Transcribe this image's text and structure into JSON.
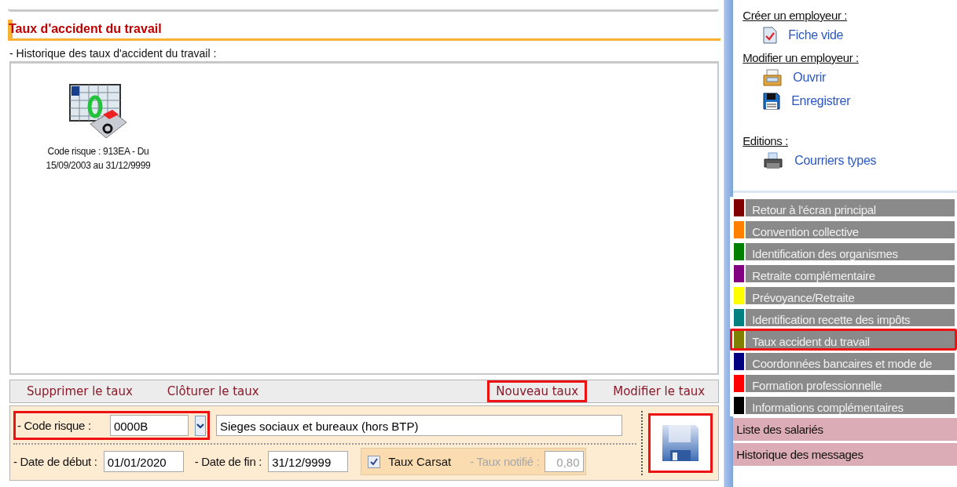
{
  "section": {
    "title": "Taux d'accident du travail"
  },
  "history": {
    "label": "- Historique des taux d'accident du travail :",
    "items": [
      {
        "caption_lines": [
          "Code risque : 913EA - Du",
          "15/09/2003 au 31/12/9999"
        ]
      }
    ]
  },
  "actions_left": [
    {
      "label": "Supprimer le taux",
      "highlighted": false
    },
    {
      "label": "Clôturer le taux",
      "highlighted": false
    }
  ],
  "actions_right": [
    {
      "label": "Nouveau taux",
      "highlighted": true
    },
    {
      "label": "Modifier le taux",
      "highlighted": false
    }
  ],
  "form": {
    "code_risque": {
      "label": "- Code risque :",
      "value": "0000B",
      "highlighted": true
    },
    "description": {
      "value": "Sieges sociaux et bureaux (hors BTP)"
    },
    "date_debut": {
      "label": "- Date de début :",
      "value": "01/01/2020"
    },
    "date_fin": {
      "label": "- Date de fin :",
      "value": "31/12/9999"
    },
    "taux_carsat": {
      "label": "Taux Carsat",
      "checked": true
    },
    "taux_notifie": {
      "label": "- Taux notifié :",
      "value": "0,80",
      "disabled": true
    },
    "save": {
      "highlighted": true
    }
  },
  "sidebar": {
    "sections": [
      {
        "heading": "Créer un employeur :",
        "links": [
          {
            "label": "Fiche vide",
            "kind": "document"
          }
        ]
      },
      {
        "heading": "Modifier un employeur :",
        "links": [
          {
            "label": "Ouvrir",
            "kind": "open"
          },
          {
            "label": "Enregistrer",
            "kind": "save"
          }
        ]
      },
      {
        "heading": "Editions :",
        "links": [
          {
            "label": "Courriers types",
            "kind": "printer"
          }
        ]
      }
    ],
    "nav": [
      {
        "label": "Retour à l'écran principal",
        "color": "#800000",
        "selected": false
      },
      {
        "label": "Convention collective",
        "color": "#ff8000",
        "selected": false
      },
      {
        "label": "Identification des organismes",
        "color": "#008000",
        "selected": false
      },
      {
        "label": "Retraite complémentaire",
        "color": "#800080",
        "selected": false
      },
      {
        "label": "Prévoyance/Retraite",
        "color": "#ffff00",
        "selected": false
      },
      {
        "label": "Identification recette des impôts",
        "color": "#008080",
        "selected": false
      },
      {
        "label": "Taux accident du travail",
        "color": "#808000",
        "selected": true
      },
      {
        "label": "Coordonnées bancaires et mode de",
        "color": "#000080",
        "selected": false
      },
      {
        "label": "Formation professionnelle",
        "color": "#ff0000",
        "selected": false
      },
      {
        "label": "Informations complémentaires",
        "color": "#000000",
        "selected": false
      }
    ],
    "bottom": [
      {
        "label": "Liste des salariés"
      },
      {
        "label": "Historique des messages"
      }
    ]
  }
}
